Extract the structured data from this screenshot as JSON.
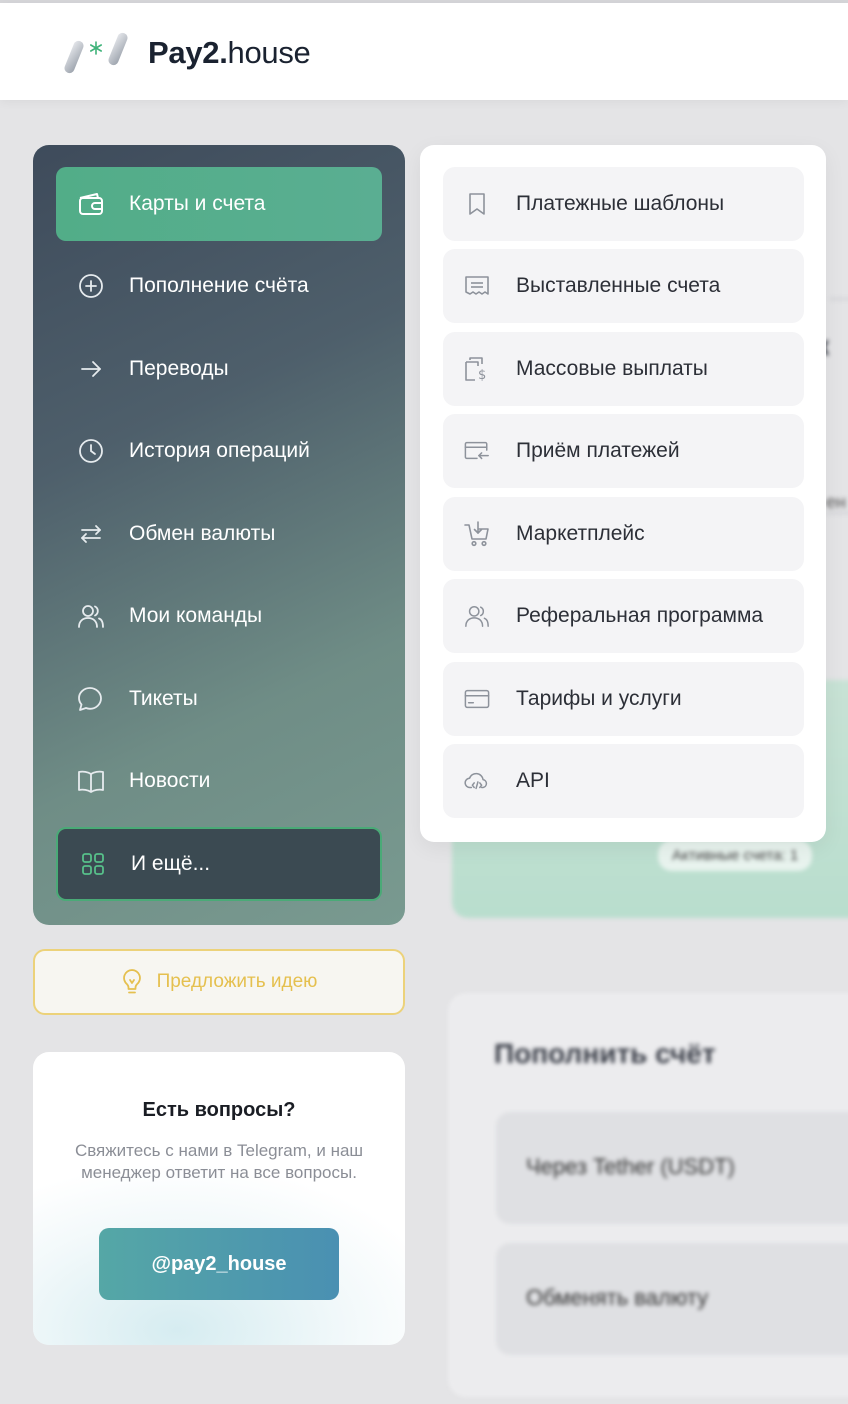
{
  "brand": {
    "name_bold": "Pay2.",
    "name_light": "house"
  },
  "sidebar": {
    "items": [
      {
        "label": "Карты и счета",
        "icon": "wallet-icon",
        "active": true
      },
      {
        "label": "Пополнение счёта",
        "icon": "plus-circle-icon"
      },
      {
        "label": "Переводы",
        "icon": "arrow-right-icon"
      },
      {
        "label": "История операций",
        "icon": "clock-icon"
      },
      {
        "label": "Обмен валюты",
        "icon": "exchange-icon"
      },
      {
        "label": "Мои команды",
        "icon": "users-icon"
      },
      {
        "label": "Тикеты",
        "icon": "chat-icon"
      },
      {
        "label": "Новости",
        "icon": "book-icon"
      },
      {
        "label": "И ещё...",
        "icon": "grid-icon"
      }
    ]
  },
  "idea_button": {
    "label": "Предложить идею",
    "icon": "lightbulb-icon"
  },
  "support": {
    "title": "Есть вопросы?",
    "text": "Свяжитесь с нами в Telegram, и наш менеджер ответит на все вопросы.",
    "button": "@pay2_house"
  },
  "more_menu": {
    "items": [
      {
        "label": "Платежные шаблоны",
        "icon": "bookmark-icon"
      },
      {
        "label": "Выставленные счета",
        "icon": "receipt-icon"
      },
      {
        "label": "Массовые выплаты",
        "icon": "mass-payout-icon"
      },
      {
        "label": "Приём платежей",
        "icon": "card-receive-icon"
      },
      {
        "label": "Маркетплейс",
        "icon": "cart-icon"
      },
      {
        "label": "Реферальная программа",
        "icon": "users-icon"
      },
      {
        "label": "Тарифы и услуги",
        "icon": "card-icon"
      },
      {
        "label": "API",
        "icon": "cloud-code-icon"
      }
    ]
  },
  "background": {
    "badge": "Активные счета: 1",
    "panel_title": "Пополнить счёт",
    "rows": [
      "Через Tether (USDT)",
      "Обменять валюту"
    ]
  },
  "colors": {
    "accent_green": "#52ad88",
    "idea_yellow": "#e5c04f",
    "telegram_button": "#4a90b2"
  }
}
